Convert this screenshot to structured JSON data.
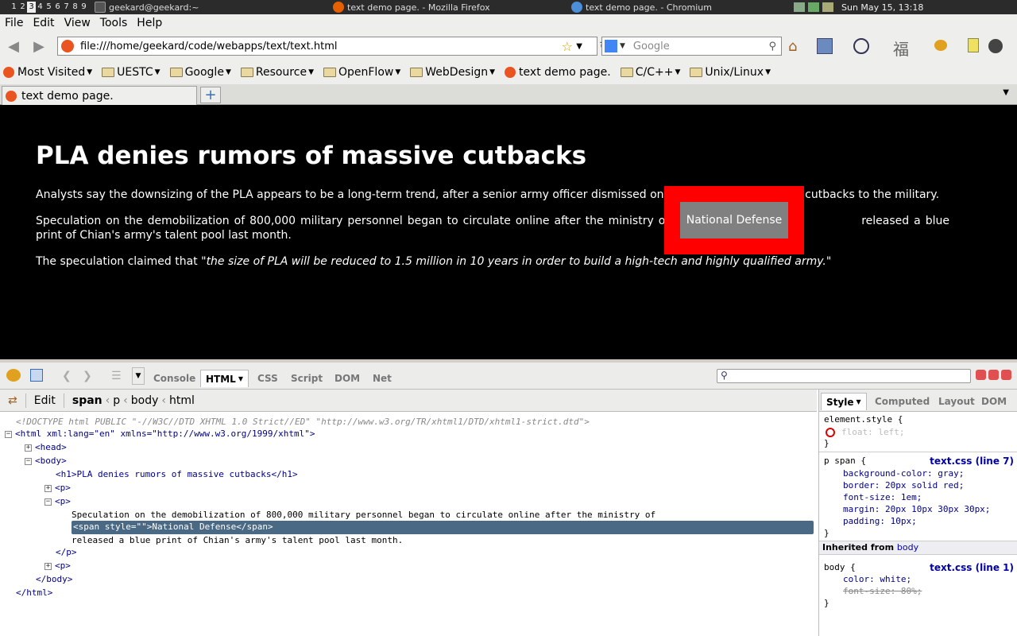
{
  "system_panel": {
    "workspaces": [
      "1",
      "2",
      "3",
      "4",
      "5",
      "6",
      "7",
      "8",
      "9"
    ],
    "active_workspace": "3",
    "tasks": [
      "geekard@geekard:~",
      "text demo page. - Mozilla Firefox",
      "text demo page. - Chromium"
    ],
    "clock": "Sun May 15, 13:18"
  },
  "menubar": {
    "file": "File",
    "edit": "Edit",
    "view": "View",
    "tools": "Tools",
    "help": "Help"
  },
  "navbar": {
    "url": "file:///home/geekard/code/webapps/text/text.html",
    "search_placeholder": "Google"
  },
  "bookmarks": [
    {
      "label": "Most Visited",
      "folder": false,
      "icon": "ubuntu-icon"
    },
    {
      "label": "UESTC",
      "folder": true
    },
    {
      "label": "Google",
      "folder": true
    },
    {
      "label": "Resource",
      "folder": true
    },
    {
      "label": "OpenFlow",
      "folder": true
    },
    {
      "label": "WebDesign",
      "folder": true
    },
    {
      "label": "text demo page.",
      "folder": false,
      "icon": "ubuntu-icon"
    },
    {
      "label": "C/C++",
      "folder": true
    },
    {
      "label": "Unix/Linux",
      "folder": true
    }
  ],
  "tabs": {
    "tab1": "text demo page.",
    "new_tab": "+"
  },
  "page": {
    "heading": "PLA denies rumors of massive cutbacks",
    "p1": "Analysts say the downsizing of the PLA appears to be a long-term trend, after a senior army officer dismissed online speculation of major cutbacks to the military.",
    "p2_before": "Speculation on the demobilization of 800,000 military personnel began to circulate online after the ministry of",
    "p2_span": "National Defense",
    "p2_after": "released a blue print of Chian's army's talent pool last month.",
    "p3_lead": "The speculation claimed that",
    "p3_quote": "\"the size of PLA will be reduced to 1.5 million in 10 years in order to build a high-tech and highly qualified army.\""
  },
  "firebug": {
    "tabs": {
      "console": "Console",
      "html": "HTML",
      "css": "CSS",
      "script": "Script",
      "dom": "DOM",
      "net": "Net"
    },
    "edit": "Edit",
    "breadcrumb": {
      "span": "span",
      "p": "p",
      "body": "body",
      "html": "html"
    },
    "tree": {
      "doctype": "<!DOCTYPE html PUBLIC \"-//W3C//DTD XHTML 1.0 Strict//ED\" \"http://www.w3.org/TR/xhtml1/DTD/xhtml1-strict.dtd\">",
      "html_open": "<html xml:lang=\"en\" xmlns=\"http://www.w3.org/1999/xhtml\">",
      "head": "<head>",
      "body_open": "<body>",
      "h1": "<h1>PLA denies rumors of massive cutbacks</h1>",
      "p_collapsed": "<p>",
      "p_open": "<p>",
      "text1": "Speculation on the demobilization of 800,000 military personnel began to circulate online after the ministry of",
      "span": "<span style=\"\">National Defense</span>",
      "text2": "released a blue print of Chian's army's talent pool last month.",
      "p_close": "</p>",
      "p3": "<p>",
      "body_close": "</body>",
      "html_close": "</html>"
    },
    "side_tabs": {
      "style": "Style",
      "computed": "Computed",
      "layout": "Layout",
      "dom": "DOM"
    },
    "element_style": "element.style {",
    "disabled_rule": "float: left;",
    "rule1_selector": "p span {",
    "rule1_source": "text.css (line 7)",
    "rule1_props": [
      "background-color: gray;",
      "border: 20px solid red;",
      "font-size: 1em;",
      "margin: 20px 10px 30px 30px;",
      "padding: 10px;"
    ],
    "inherited_label": "Inherited from",
    "inherited_from": "body",
    "rule2_selector": "body {",
    "rule2_source": "text.css (line 1)",
    "rule2_prop1": "color: white;",
    "rule2_prop2": "font-size: 80%;",
    "close_brace": "}"
  },
  "colors": {
    "accent_red": "#ff0000",
    "span_bg": "#808080",
    "selection": "#4a6984"
  }
}
